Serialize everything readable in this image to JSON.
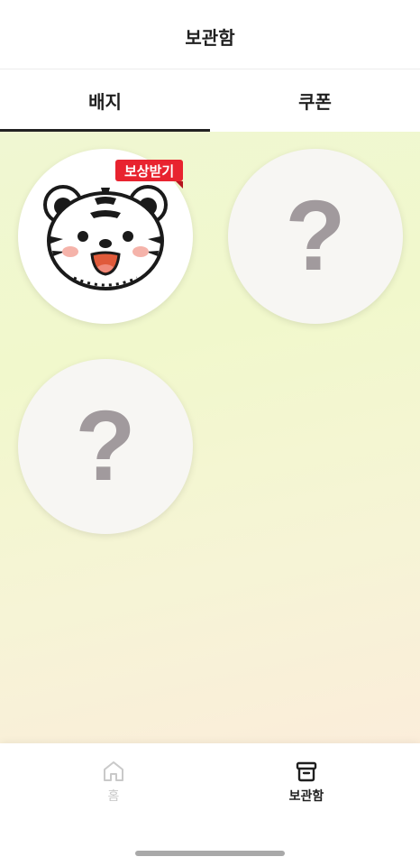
{
  "header": {
    "title": "보관함"
  },
  "tabs": [
    {
      "label": "배지",
      "active": true
    },
    {
      "label": "쿠폰",
      "active": false
    }
  ],
  "badges": [
    {
      "status": "owned",
      "icon": "tiger-badge-icon",
      "reward_label": "보상받기"
    },
    {
      "status": "locked",
      "symbol": "?"
    },
    {
      "status": "locked",
      "symbol": "?"
    }
  ],
  "colors": {
    "reward_tag": "#e8232f",
    "locked_badge_symbol": "#a19a9d",
    "active_tab_underline": "#222222"
  },
  "bottom_nav": {
    "items": [
      {
        "label": "홈",
        "icon": "home-icon",
        "active": false
      },
      {
        "label": "보관함",
        "icon": "archive-box-icon",
        "active": true
      }
    ]
  }
}
